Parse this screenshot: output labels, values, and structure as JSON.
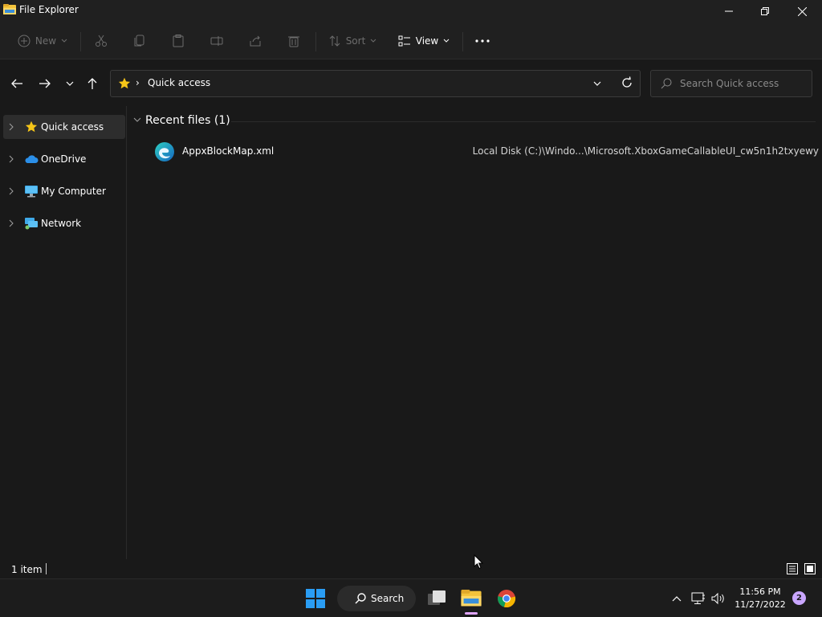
{
  "window": {
    "title": "File Explorer"
  },
  "toolbar": {
    "new_label": "New",
    "sort_label": "Sort",
    "view_label": "View"
  },
  "address": {
    "location": "Quick access"
  },
  "search": {
    "placeholder": "Search Quick access"
  },
  "sidebar": {
    "items": [
      {
        "label": "Quick access",
        "icon": "star-icon"
      },
      {
        "label": "OneDrive",
        "icon": "cloud-icon"
      },
      {
        "label": "My Computer",
        "icon": "computer-icon"
      },
      {
        "label": "Network",
        "icon": "network-icon"
      }
    ]
  },
  "content": {
    "group_title": "Recent files (1)",
    "files": [
      {
        "name": "AppxBlockMap.xml",
        "path": "Local Disk (C:)\\Windo...\\Microsoft.XboxGameCallableUI_cw5n1h2txyewy",
        "icon": "edge-icon"
      }
    ]
  },
  "status": {
    "item_count": "1 item"
  },
  "taskbar": {
    "search_label": "Search",
    "time": "11:56 PM",
    "date": "11/27/2022",
    "notification_count": "2"
  },
  "colors": {
    "accent_star": "#f5c518",
    "window_bg": "#191919",
    "chrome_bg": "#202020"
  }
}
